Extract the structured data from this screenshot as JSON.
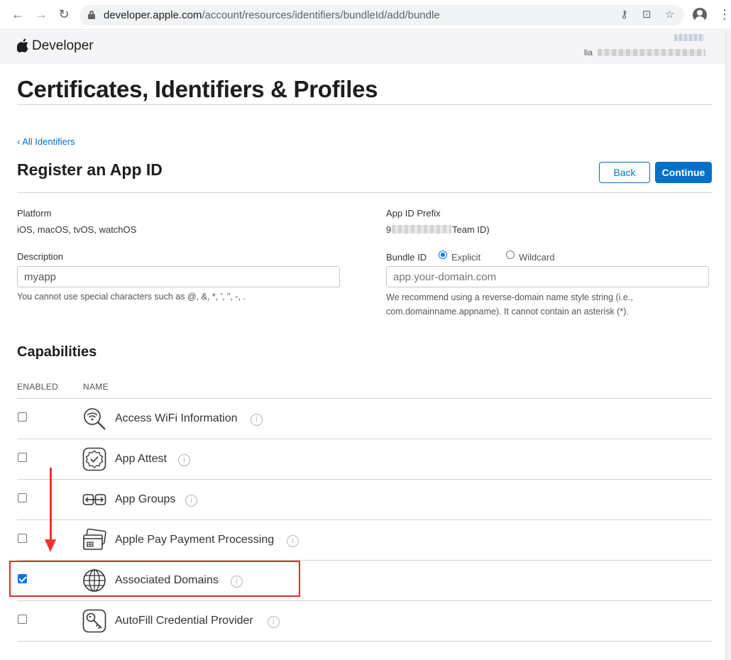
{
  "browser": {
    "url_host": "developer.apple.com",
    "url_path": "/account/resources/identifiers/bundleId/add/bundle"
  },
  "header": {
    "brand": "Developer",
    "account_label": "lia"
  },
  "page": {
    "title": "Certificates, Identifiers & Profiles",
    "back_link": "‹ All Identifiers",
    "section_title": "Register an App ID",
    "back_button": "Back",
    "continue_button": "Continue"
  },
  "form": {
    "platform_label": "Platform",
    "platform_value": "iOS, macOS, tvOS, watchOS",
    "prefix_label": "App ID Prefix",
    "prefix_value_start": "9",
    "prefix_value_end": "Team ID)",
    "description_label": "Description",
    "description_value": "myapp",
    "description_hint": "You cannot use special characters such as @, &, *, ', \", -, .",
    "bundle_label": "Bundle ID",
    "explicit_label": "Explicit",
    "wildcard_label": "Wildcard",
    "bundle_placeholder": "app.your-domain.com",
    "bundle_hint_line1": "We recommend using a reverse-domain name style string (i.e.,",
    "bundle_hint_line2": "com.domainname.appname). It cannot contain an asterisk (*)."
  },
  "capabilities": {
    "title": "Capabilities",
    "col_enabled": "ENABLED",
    "col_name": "NAME",
    "items": [
      {
        "name": "Access WiFi Information",
        "enabled": false,
        "icon": "wifi-search-icon"
      },
      {
        "name": "App Attest",
        "enabled": false,
        "icon": "badge-check-icon"
      },
      {
        "name": "App Groups",
        "enabled": false,
        "icon": "app-groups-icon"
      },
      {
        "name": "Apple Pay Payment Processing",
        "enabled": false,
        "icon": "payment-cards-icon"
      },
      {
        "name": "Associated Domains",
        "enabled": true,
        "icon": "globe-icon"
      },
      {
        "name": "AutoFill Credential Provider",
        "enabled": false,
        "icon": "key-icon"
      }
    ]
  },
  "annotation": {
    "highlight_color": "#e02b2b"
  }
}
